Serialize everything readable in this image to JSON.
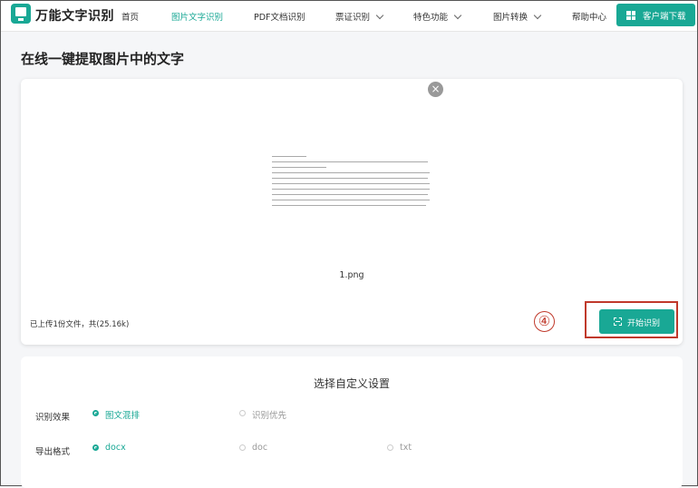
{
  "header": {
    "brand": "万能文字识别",
    "nav": [
      {
        "label": "首页"
      },
      {
        "label": "图片文字识别"
      },
      {
        "label": "PDF文档识别"
      },
      {
        "label": "票证识别"
      },
      {
        "label": "特色功能"
      },
      {
        "label": "图片转换"
      },
      {
        "label": "帮助中心"
      }
    ],
    "download_label": "客户端下载"
  },
  "page_title": "在线一键提取图片中的文字",
  "upload": {
    "close_glyph": "×",
    "filename": "1.png",
    "info": "已上传1份文件，共(25.16k)",
    "start_label": "开始识别",
    "annotation": "④"
  },
  "settings": {
    "title": "选择自定义设置",
    "effect_label": "识别效果",
    "effect_options": [
      {
        "label": "图文混排",
        "selected": true
      },
      {
        "label": "识别优先",
        "selected": false
      }
    ],
    "format_label": "导出格式",
    "format_options": [
      {
        "label": "docx",
        "selected": true
      },
      {
        "label": "doc",
        "selected": false
      },
      {
        "label": "txt",
        "selected": false
      }
    ]
  },
  "colors": {
    "accent": "#19a895",
    "annotation": "#c0392b"
  }
}
